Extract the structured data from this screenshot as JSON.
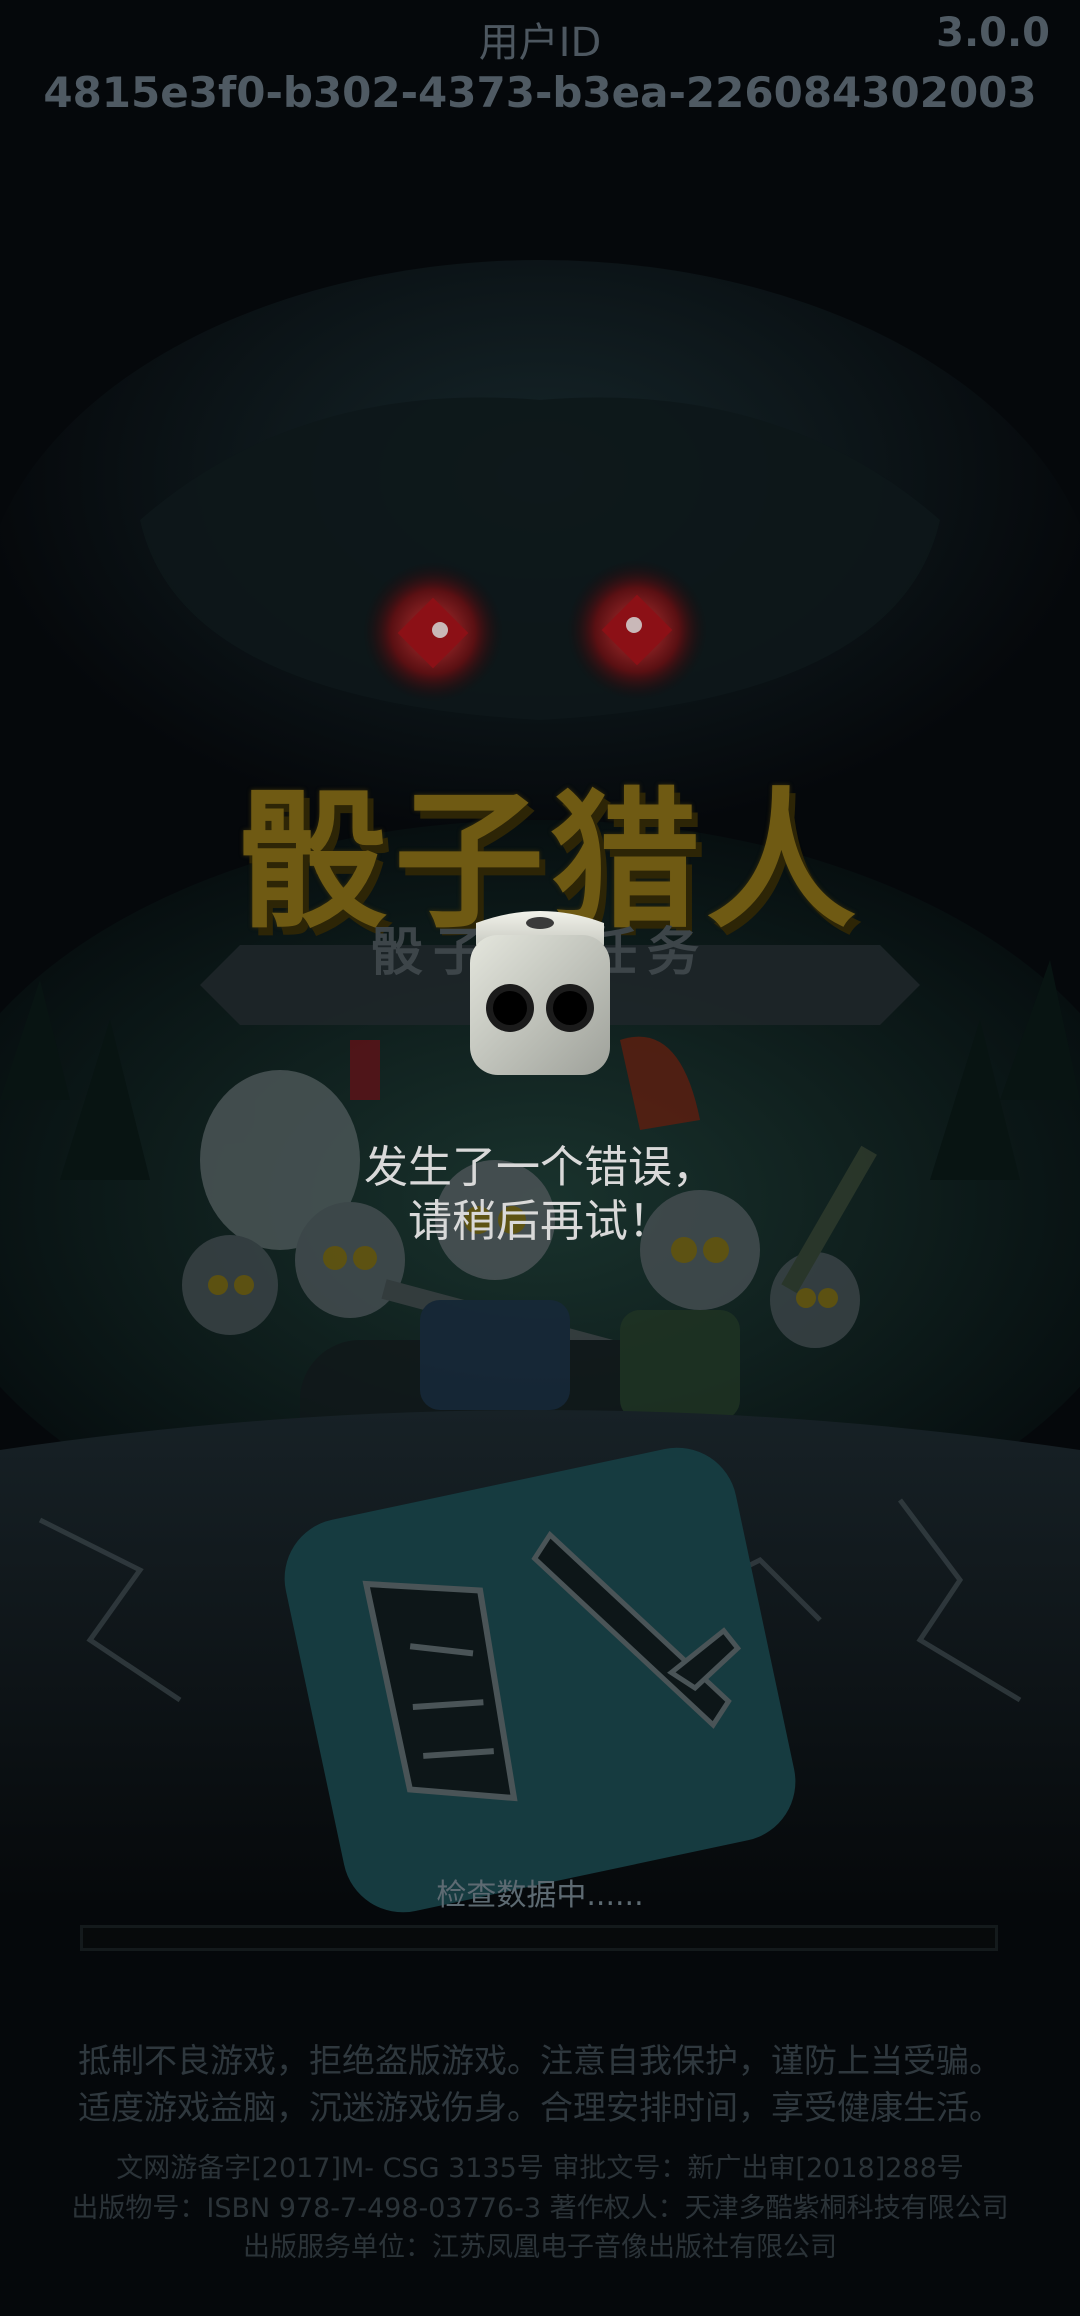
{
  "header": {
    "user_id_label": "用户ID",
    "user_id_value": "4815e3f0-b302-4373-b3ea-226084302003",
    "version": "3.0.0"
  },
  "game": {
    "title": "骰子猎人",
    "subtitle": "骰子 的任务"
  },
  "error": {
    "line1": "发生了一个错误，",
    "line2": "请稍后再试！"
  },
  "loading": {
    "text": "检查数据中......",
    "progress": 0
  },
  "notices": {
    "line1": "抵制不良游戏，拒绝盗版游戏。注意自我保护，谨防上当受骗。",
    "line2": "适度游戏益脑，沉迷游戏伤身。合理安排时间，享受健康生活。"
  },
  "legal": {
    "line1": "文网游备字[2017]M- CSG 3135号   审批文号：新广出审[2018]288号",
    "line2": "出版物号：ISBN 978-7-498-03776-3   著作权人：天津多酷紫桐科技有限公司",
    "line3": "出版服务单位：江苏凤凰电子音像出版社有限公司"
  },
  "colors": {
    "background": "#05080b",
    "title_gold": "#6f5a13",
    "error_text": "#d9d9d9"
  }
}
